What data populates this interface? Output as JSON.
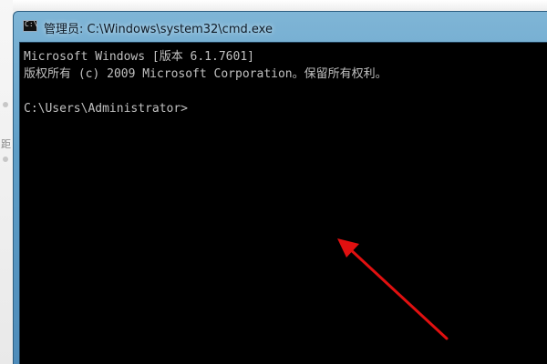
{
  "window": {
    "title": "管理员: C:\\Windows\\system32\\cmd.exe",
    "icon": "cmd-icon"
  },
  "background": {
    "fragment": "距"
  },
  "console": {
    "lines": [
      "Microsoft Windows [版本 6.1.7601]",
      "版权所有 (c) 2009 Microsoft Corporation。保留所有权利。",
      "",
      "C:\\Users\\Administrator>"
    ]
  },
  "annotation": {
    "icon": "red-arrow-icon",
    "color": "#e01010"
  },
  "colors": {
    "console_bg": "#000000",
    "console_text": "#c0c0c0",
    "titlebar": "#5f9ec7"
  }
}
